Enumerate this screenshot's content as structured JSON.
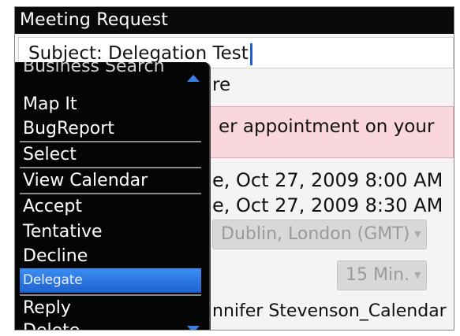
{
  "window": {
    "title": "Meeting Request"
  },
  "form": {
    "subject": "Subject: Delegation Test",
    "location_partial": "re",
    "conflict_notice_partial": "er appointment on your",
    "start_partial": "e, Oct 27, 2009 8:00 AM",
    "end_partial": "e, Oct 27, 2009 8:30 AM",
    "timezone_partial": "Dublin, London (GMT)",
    "reminder": "15 Min.",
    "calendar_partial": "nnifer Stevenson_Calendar"
  },
  "menu": {
    "items": [
      {
        "label": "Business Search",
        "separator": false,
        "selected": false
      },
      {
        "label": "Map It",
        "separator": false,
        "selected": false
      },
      {
        "label": "BugReport",
        "separator": false,
        "selected": false
      },
      {
        "label": "Select",
        "separator": true,
        "selected": false
      },
      {
        "label": "View Calendar",
        "separator": true,
        "selected": false
      },
      {
        "label": "Accept",
        "separator": true,
        "selected": false
      },
      {
        "label": "Tentative",
        "separator": false,
        "selected": false
      },
      {
        "label": "Decline",
        "separator": false,
        "selected": false
      },
      {
        "label": "Delegate",
        "separator": false,
        "selected": true
      },
      {
        "label": "Reply",
        "separator": true,
        "selected": false
      },
      {
        "label": "Delete",
        "separator": false,
        "selected": false
      }
    ]
  },
  "icons": {
    "scroll_up": "scroll-up-arrow",
    "scroll_down": "scroll-down-arrow",
    "dropdown": "dropdown-arrow"
  },
  "colors": {
    "title_bg": "#0a0a0a",
    "notice_bg": "#f9d7dc",
    "selection": "#2a74e6",
    "menu_bg": "#050505"
  }
}
